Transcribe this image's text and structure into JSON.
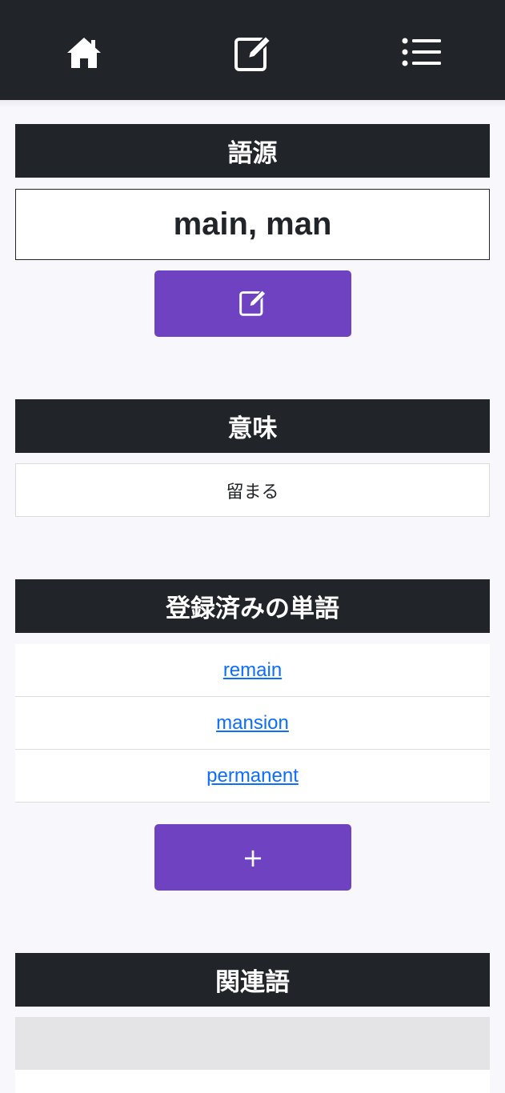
{
  "navbar": {
    "icons": [
      "home-icon",
      "edit-icon",
      "list-icon"
    ],
    "background": "#212529"
  },
  "etymology": {
    "header": "語源",
    "value": "main, man",
    "edit_button_icon": "edit-icon"
  },
  "meaning": {
    "header": "意味",
    "value": "留まる"
  },
  "registered_words": {
    "header": "登録済みの単語",
    "items": [
      "remain",
      "mansion",
      "permanent"
    ],
    "add_button_label": "+"
  },
  "related_words": {
    "header": "関連語"
  },
  "colors": {
    "accent": "#6f42c1",
    "link": "#0d6efd",
    "dark": "#212529"
  }
}
